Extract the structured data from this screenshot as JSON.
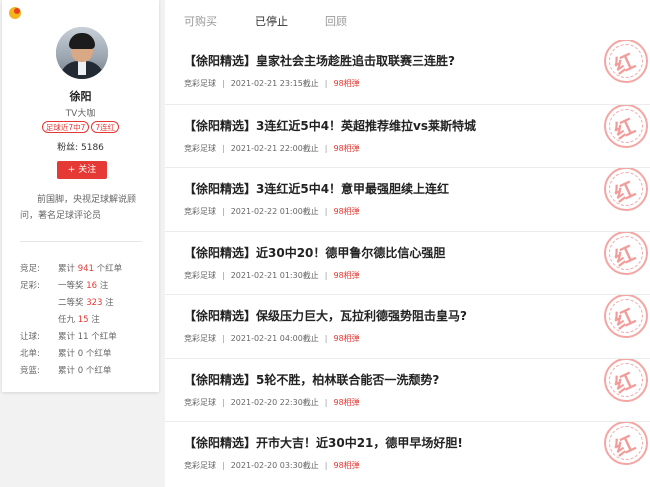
{
  "expert": {
    "name": "徐阳",
    "title": "TV大咖",
    "badges": [
      "足球近7中7",
      "7连红"
    ],
    "fans_label": "粉丝:",
    "fans_count": "5186",
    "follow_label": "+ 关注",
    "intro": "前国脚，央视足球解说顾问，著名足球评论员"
  },
  "stats": [
    {
      "key": "竞足:",
      "prefix": "累计 ",
      "num": "941",
      "suffix": " 个红单",
      "num_red": true
    },
    {
      "key": "足彩:",
      "prefix": "一等奖 ",
      "num": "16",
      "suffix": " 注",
      "num_red": true
    },
    {
      "key": "",
      "prefix": "二等奖 ",
      "num": "323",
      "suffix": " 注",
      "num_red": true
    },
    {
      "key": "",
      "prefix": "任九 ",
      "num": "15",
      "suffix": " 注",
      "num_red": true
    },
    {
      "key": "让球:",
      "prefix": "累计 ",
      "num": "11",
      "suffix": " 个红单",
      "num_red": false
    },
    {
      "key": "北单:",
      "prefix": "累计 ",
      "num": "0",
      "suffix": " 个红单",
      "num_red": false
    },
    {
      "key": "竞篮:",
      "prefix": "累计 ",
      "num": "0",
      "suffix": " 个红单",
      "num_red": false
    }
  ],
  "tabs": [
    "可购买",
    "已停止",
    "回顾"
  ],
  "active_tab": "已停止",
  "stamp_text": "红",
  "items": [
    {
      "title": "【徐阳精选】皇家社会主场趁胜追击取联赛三连胜?",
      "category": "竞彩足球",
      "deadline": "2021-02-21 23:15截止",
      "price": "98相弹"
    },
    {
      "title": "【徐阳精选】3连红近5中4！英超推荐维拉vs莱斯特城",
      "category": "竞彩足球",
      "deadline": "2021-02-21 22:00截止",
      "price": "98相弹"
    },
    {
      "title": "【徐阳精选】3连红近5中4！意甲最强胆续上连红",
      "category": "竞彩足球",
      "deadline": "2021-02-22 01:00截止",
      "price": "98相弹"
    },
    {
      "title": "【徐阳精选】近30中20！德甲鲁尔德比信心强胆",
      "category": "竞彩足球",
      "deadline": "2021-02-21 01:30截止",
      "price": "98相弹"
    },
    {
      "title": "【徐阳精选】保级压力巨大，瓦拉利德强势阻击皇马?",
      "category": "竞彩足球",
      "deadline": "2021-02-21 04:00截止",
      "price": "98相弹"
    },
    {
      "title": "【徐阳精选】5轮不胜，柏林联合能否一洗颓势?",
      "category": "竞彩足球",
      "deadline": "2021-02-20 22:30截止",
      "price": "98相弹"
    },
    {
      "title": "【徐阳精选】开市大吉！近30中21，德甲早场好胆!",
      "category": "竞彩足球",
      "deadline": "2021-02-20 03:30截止",
      "price": "98相弹"
    }
  ]
}
